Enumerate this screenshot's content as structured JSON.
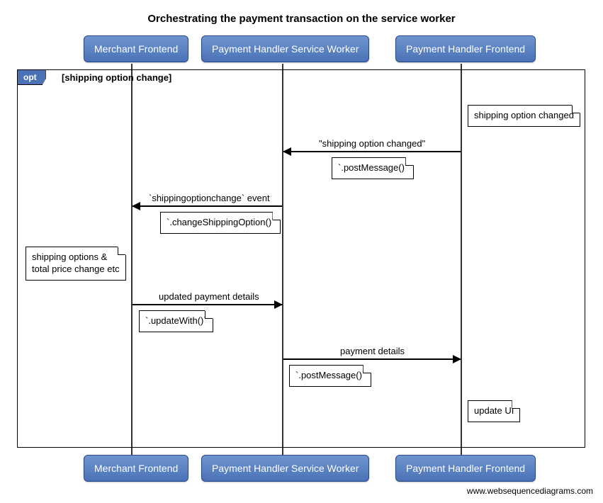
{
  "title": "Orchestrating the payment transaction on the service worker",
  "participants": {
    "p1": "Merchant Frontend",
    "p2": "Payment Handler Service Worker",
    "p3": "Payment Handler Frontend"
  },
  "frame": {
    "label": "opt",
    "guard": "[shipping option change]"
  },
  "messages": {
    "m1": {
      "label": "\"shipping option changed\"",
      "note": "`.postMessage()`"
    },
    "m2": {
      "label": "`shippingoptionchange` event",
      "note": "`.changeShippingOption()`"
    },
    "m3": {
      "label": "updated payment details",
      "note": "`.updateWith()`"
    },
    "m4": {
      "label": "payment details",
      "note": "`.postMessage()`"
    }
  },
  "notes": {
    "n1": "shipping option changed",
    "n2": "shipping options &\ntotal price change etc",
    "n3": "update UI"
  },
  "credit": "www.websequencediagrams.com",
  "chart_data": {
    "type": "sequence-diagram",
    "title": "Orchestrating the payment transaction on the service worker",
    "participants": [
      "Merchant Frontend",
      "Payment Handler Service Worker",
      "Payment Handler Frontend"
    ],
    "fragments": [
      {
        "type": "opt",
        "guard": "shipping option change",
        "steps": [
          {
            "type": "note",
            "over": "Payment Handler Frontend",
            "text": "shipping option changed"
          },
          {
            "type": "message",
            "from": "Payment Handler Frontend",
            "to": "Payment Handler Service Worker",
            "label": "\"shipping option changed\"",
            "mechanism": ".postMessage()"
          },
          {
            "type": "message",
            "from": "Payment Handler Service Worker",
            "to": "Merchant Frontend",
            "label": "`shippingoptionchange` event",
            "mechanism": ".changeShippingOption()"
          },
          {
            "type": "note",
            "over": "Merchant Frontend",
            "text": "shipping options & total price change etc"
          },
          {
            "type": "message",
            "from": "Merchant Frontend",
            "to": "Payment Handler Service Worker",
            "label": "updated payment details",
            "mechanism": ".updateWith()"
          },
          {
            "type": "message",
            "from": "Payment Handler Service Worker",
            "to": "Payment Handler Frontend",
            "label": "payment details",
            "mechanism": ".postMessage()"
          },
          {
            "type": "note",
            "over": "Payment Handler Frontend",
            "text": "update UI"
          }
        ]
      }
    ]
  }
}
